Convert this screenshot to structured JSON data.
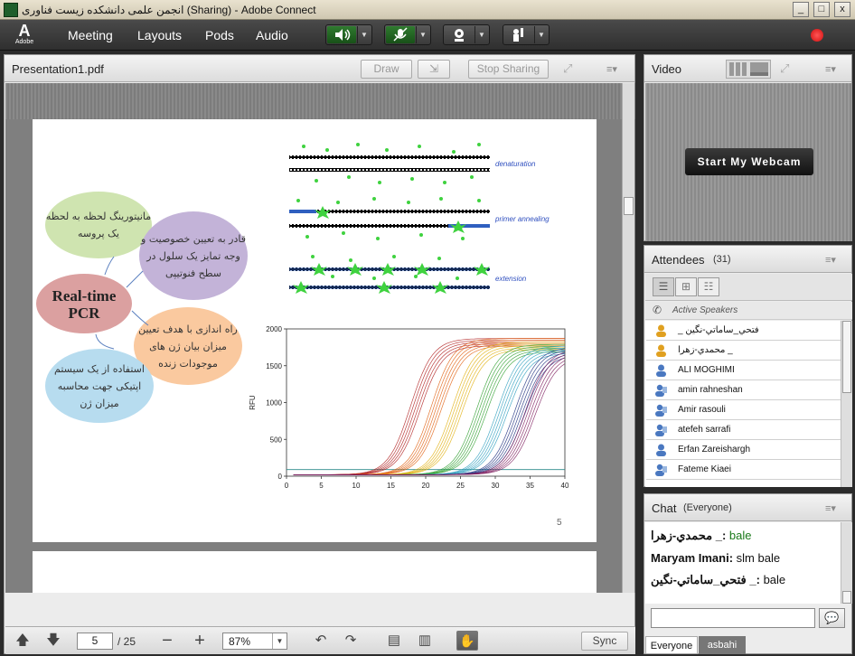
{
  "window": {
    "title": "انجمن علمی دانشکده زیست فناوری (Sharing) - Adobe Connect",
    "min_label": "_",
    "max_label": "□",
    "close_label": "x"
  },
  "logo": {
    "mark": "A",
    "text": "Adobe"
  },
  "menu": {
    "items": [
      "Meeting",
      "Layouts",
      "Pods",
      "Audio"
    ]
  },
  "share_pod": {
    "title": "Presentation1.pdf",
    "draw_label": "Draw",
    "stop_sharing_label": "Stop Sharing",
    "slide": {
      "center_label_1": "Real-time",
      "center_label_2": "PCR",
      "bubbles": [
        "مانیتورینگ لحظه به لحظه یک پروسه",
        "قادر به تعیین خصوصیت و وجه تمایز یک سلول در سطح فنوتیپی",
        "راه اندازی با هدف تعیین میزان بیان ژن های موجودات زنده",
        "استفاده از یک سیستم اپتیکی جهت محاسبه میزان ژن"
      ],
      "diagram_labels": [
        "denaturation",
        "primer annealing",
        "extension"
      ],
      "page_number_label": "5"
    },
    "pager": {
      "current_page": "5",
      "total_label": "/ 25",
      "zoom": "87%",
      "sync_label": "Sync"
    }
  },
  "chart_data": {
    "type": "line",
    "title": "",
    "xlabel": "",
    "ylabel": "RFU",
    "xlim": [
      0,
      40
    ],
    "ylim": [
      0,
      2000
    ],
    "xticks": [
      0,
      5,
      10,
      15,
      20,
      25,
      30,
      35,
      40
    ],
    "yticks": [
      0,
      500,
      1000,
      1500,
      2000
    ],
    "series": [
      {
        "color": "#b02020",
        "midpoint": 18.5,
        "plateau": 1800
      },
      {
        "color": "#e06010",
        "midpoint": 21.5,
        "plateau": 1800
      },
      {
        "color": "#e0b010",
        "midpoint": 24.5,
        "plateau": 1750
      },
      {
        "color": "#30a030",
        "midpoint": 28,
        "plateau": 1720
      },
      {
        "color": "#30a0c0",
        "midpoint": 31,
        "plateau": 1700
      },
      {
        "color": "#203080",
        "midpoint": 33.5,
        "plateau": 1680
      },
      {
        "color": "#802060",
        "midpoint": 35,
        "plateau": 1660
      }
    ],
    "grid": false,
    "legend": "none"
  },
  "video_pod": {
    "title": "Video",
    "webcam_button": "Start My Webcam"
  },
  "attendees_pod": {
    "title": "Attendees",
    "count": "(31)",
    "section": "Active Speakers",
    "people": [
      "فتحي_ساماتي-نگين _",
      "محمدي-زهرا _",
      "ALI MOGHIMI",
      "amin rahneshan",
      "Amir rasouli",
      "atefeh sarrafi",
      "Erfan Zareishargh",
      "Fateme Kiaei"
    ]
  },
  "chat_pod": {
    "title": "Chat",
    "scope": "(Everyone)",
    "messages": [
      {
        "author": "محمدي-زهرا _",
        "text": "bale"
      },
      {
        "author": "Maryam Imani",
        "text": "slm bale"
      },
      {
        "author": "فتحي_ساماتي-نگين _",
        "text": "bale"
      }
    ],
    "input_value": "",
    "tabs": [
      "Everyone",
      "asbahi"
    ]
  },
  "colors": {
    "accent_green": "#1a7a1a",
    "record_red": "#e01010"
  }
}
